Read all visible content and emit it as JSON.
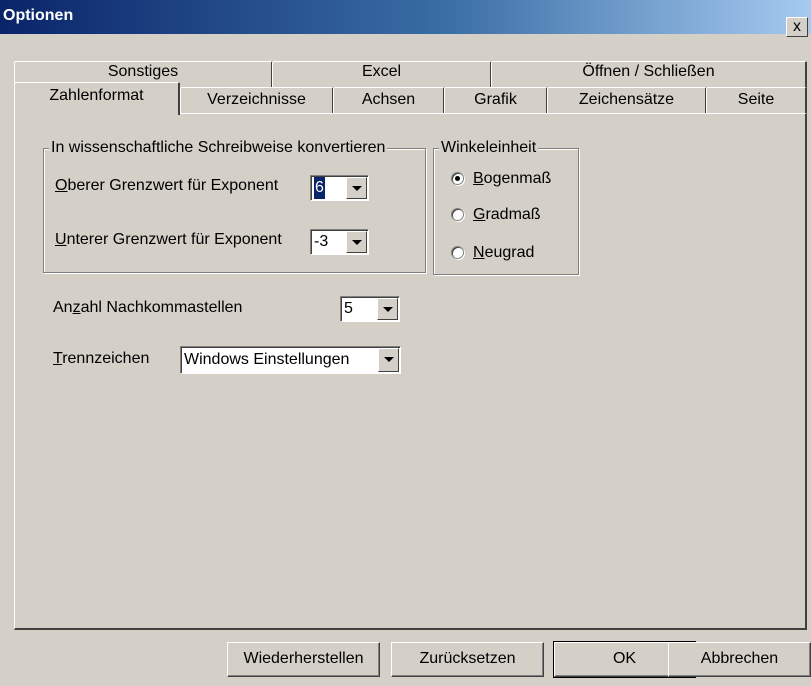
{
  "window": {
    "title": "Optionen",
    "close_label": "x"
  },
  "tabs_back": [
    {
      "label": "Sonstiges"
    },
    {
      "label": "Excel"
    },
    {
      "label": "Öffnen / Schließen"
    }
  ],
  "tabs_front": [
    {
      "label": "Zahlenformat",
      "active": true
    },
    {
      "label": "Verzeichnisse"
    },
    {
      "label": "Achsen"
    },
    {
      "label": "Grafik"
    },
    {
      "label": "Zeichensätze"
    },
    {
      "label": "Seite"
    }
  ],
  "scientific_group": {
    "legend": "In wissenschaftliche Schreibweise konvertieren",
    "upper": {
      "label_accel": "O",
      "label_rest": "berer Grenzwert für Exponent",
      "value": "6"
    },
    "lower": {
      "label_accel": "U",
      "label_rest": "nterer Grenzwert für Exponent",
      "value": "-3"
    }
  },
  "angle_group": {
    "legend": "Winkeleinheit",
    "options": [
      {
        "accel": "B",
        "rest": "ogenmaß",
        "checked": true
      },
      {
        "accel": "G",
        "rest": "radmaß",
        "checked": false
      },
      {
        "accel": "N",
        "rest": "eugrad",
        "checked": false
      }
    ]
  },
  "decimals": {
    "label_pre": "An",
    "label_accel": "z",
    "label_post": "ahl Nachkommastellen",
    "value": "5"
  },
  "separator": {
    "label_accel": "T",
    "label_rest": "rennzeichen",
    "value": "Windows Einstellungen"
  },
  "buttons": {
    "restore": "Wiederherstellen",
    "reset": "Zurücksetzen",
    "ok": "OK",
    "cancel": "Abbrechen"
  }
}
